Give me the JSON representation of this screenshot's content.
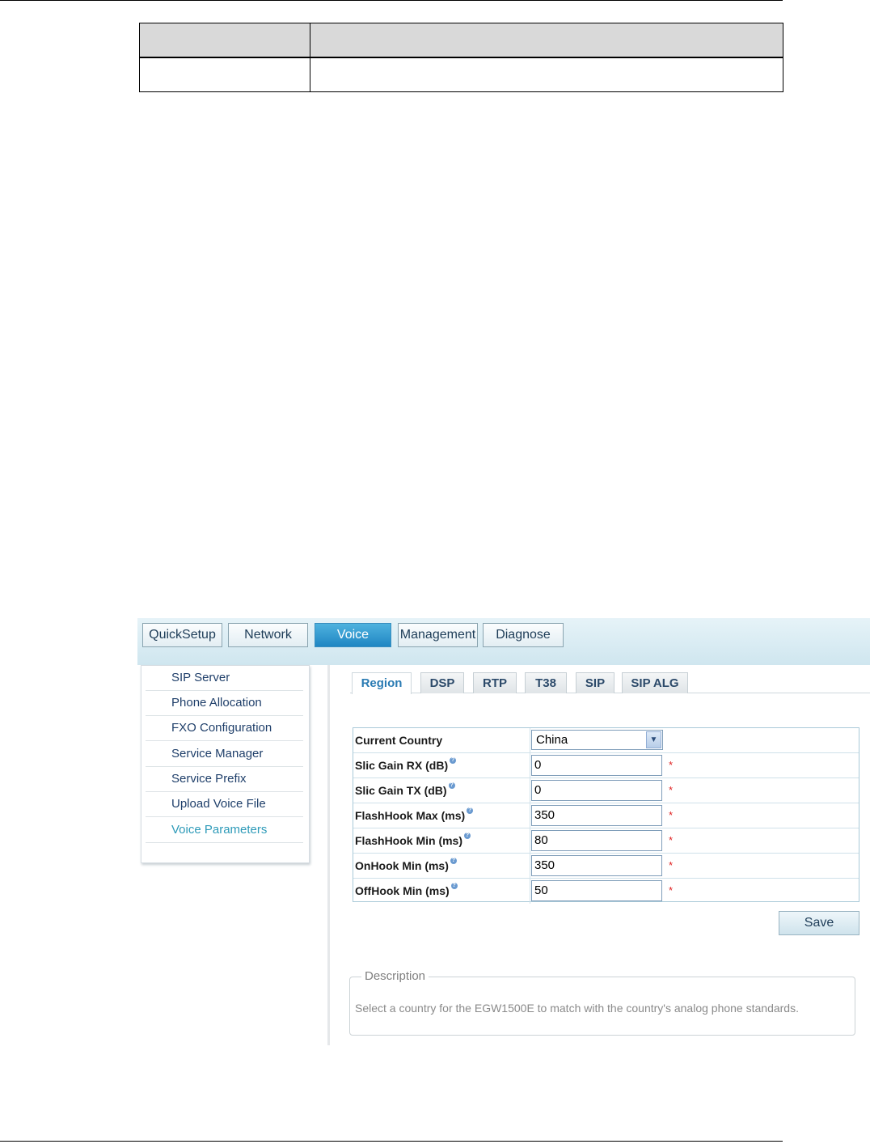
{
  "nav": [
    "QuickSetup",
    "Network",
    "Voice",
    "Management",
    "Diagnose"
  ],
  "sidebar": [
    "SIP Server",
    "Phone Allocation",
    "FXO Configuration",
    "Service Manager",
    "Service Prefix",
    "Upload Voice File",
    "Voice Parameters"
  ],
  "tabs": [
    "Region",
    "DSP",
    "RTP",
    "T38",
    "SIP",
    "SIP ALG"
  ],
  "form": {
    "current_country_label": "Current Country",
    "current_country_value": "China",
    "fields": [
      {
        "label": "Slic Gain RX (dB)",
        "value": "0"
      },
      {
        "label": "Slic Gain TX (dB)",
        "value": "0"
      },
      {
        "label": "FlashHook Max (ms)",
        "value": "350"
      },
      {
        "label": "FlashHook Min (ms)",
        "value": "80"
      },
      {
        "label": "OnHook Min (ms)",
        "value": "350"
      },
      {
        "label": "OffHook Min (ms)",
        "value": "50"
      }
    ],
    "required_mark": "*",
    "help_mark": "?"
  },
  "save_label": "Save",
  "description": {
    "title": "Description",
    "text": "Select a country for the EGW1500E to match with the country's analog phone standards."
  },
  "colors": {
    "active_nav": "#1f86c3",
    "active_sidebar": "#2d9ab8",
    "required": "#e02020"
  }
}
